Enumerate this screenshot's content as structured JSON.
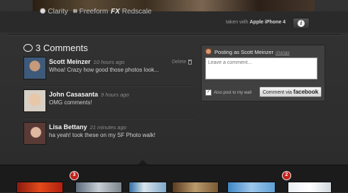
{
  "filters": [
    {
      "label": "Clarity",
      "icon": "sparkle-icon"
    },
    {
      "label": "Freeform",
      "icon": "crop-icon"
    },
    {
      "label": "Redscale",
      "icon": "fx-icon",
      "prefix": "FX"
    }
  ],
  "photo_info": {
    "taken_prefix": "taken with",
    "device": "Apple iPhone 4",
    "info_label": "i"
  },
  "comments_header": "3 Comments",
  "comments": [
    {
      "name": "Scott Meinzer",
      "time": "10 hours ago",
      "text": "Whoa! Crazy how good those photos look..."
    },
    {
      "name": "John Casasanta",
      "time": "9 hours ago",
      "text": "OMG comments!"
    },
    {
      "name": "Lisa Bettany",
      "time": "21 minutes ago",
      "text": "ha yeah! took these on my SF Photo walk!"
    }
  ],
  "delete_label": "Delete",
  "post_box": {
    "posting_as": "Posting as Scott Meinzer",
    "change_label": "change",
    "placeholder": "Leave a comment...",
    "also_post_label": "Also post to my wall",
    "also_post_checked": true,
    "button_prefix": "Comment via",
    "button_brand": "facebook"
  },
  "carousel": {
    "badges": [
      "3",
      "2"
    ],
    "colors": {
      "badge": "#c4211b"
    }
  }
}
